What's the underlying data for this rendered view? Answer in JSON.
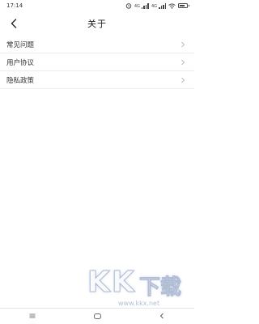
{
  "status_bar": {
    "time": "17:14",
    "signal_labels": [
      "4G",
      "4G"
    ],
    "battery_level": 0.8,
    "icons": [
      "alarm-icon",
      "signal-icon",
      "signal-icon",
      "wifi-icon",
      "battery-icon"
    ]
  },
  "header": {
    "back_icon": "back-chevron-icon",
    "title": "关于"
  },
  "menu": {
    "items": [
      {
        "label": "常见问题"
      },
      {
        "label": "用户协议"
      },
      {
        "label": "隐私政策"
      }
    ]
  },
  "bottom_nav": {
    "buttons": [
      "menu-icon",
      "home-icon",
      "back-icon"
    ]
  },
  "watermark": {
    "brand": [
      "K",
      "K",
      "下载"
    ],
    "url": "www.kkx.net"
  },
  "colors": {
    "background": "#ffffff",
    "divider": "#ececec",
    "text": "#333333",
    "chevron": "#bbbbbb"
  }
}
